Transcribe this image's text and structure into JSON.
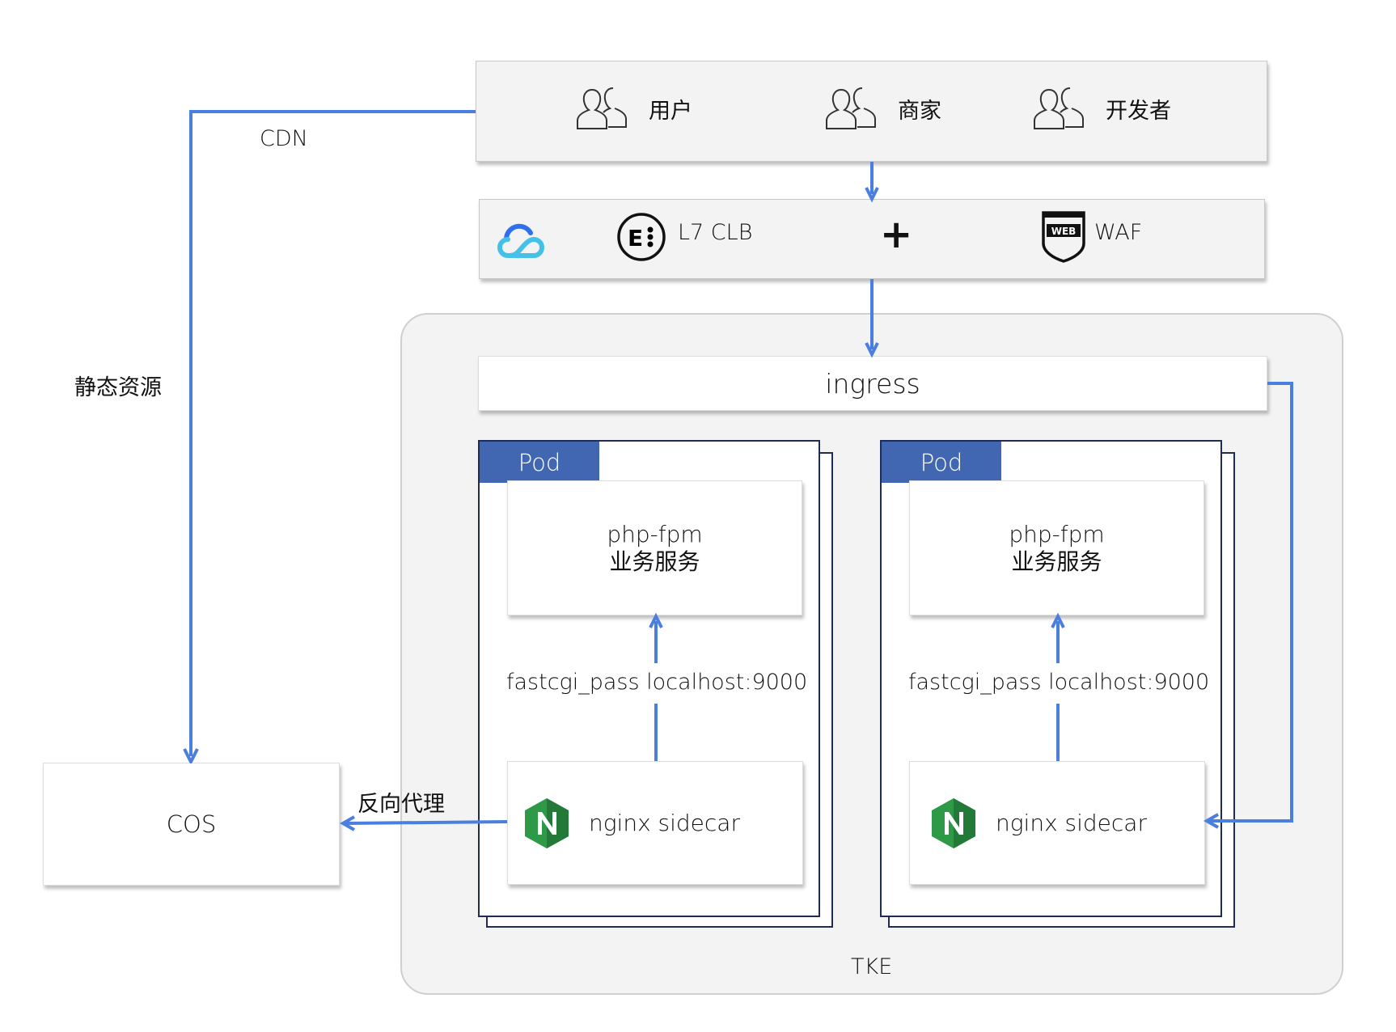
{
  "users_row": [
    {
      "label": "用户",
      "icon": "users-icon"
    },
    {
      "label": "商家",
      "icon": "users-icon"
    },
    {
      "label": "开发者",
      "icon": "users-icon"
    }
  ],
  "gateway": {
    "clb_label": "L7 CLB",
    "plus": "+",
    "waf_label": "WAF",
    "waf_icon_text": "WEB"
  },
  "ingress": "ingress",
  "pods": [
    {
      "tag": "Pod",
      "app_line1": "php-fpm",
      "app_line2": "业务服务",
      "link_label": "fastcgi_pass localhost:9000",
      "sidecar": "nginx sidecar"
    },
    {
      "tag": "Pod",
      "app_line1": "php-fpm",
      "app_line2": "业务服务",
      "link_label": "fastcgi_pass localhost:9000",
      "sidecar": "nginx sidecar"
    }
  ],
  "tke_label": "TKE",
  "cos_label": "COS",
  "cdn_label": "CDN",
  "static_label": "静态资源",
  "proxy_label": "反向代理",
  "colors": {
    "arrow": "#4a7fe0",
    "pod_tag": "#4267b2",
    "pod_border": "#1f2d55",
    "panel": "#f3f3f3",
    "nginx": "#2e9a48"
  }
}
